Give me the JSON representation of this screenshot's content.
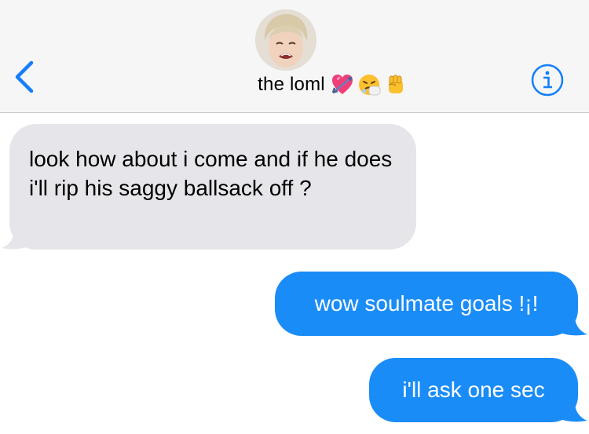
{
  "header": {
    "contact_name": "the loml",
    "emoji_icons": [
      "heart-with-arrow-icon",
      "sneezing-face-icon",
      "raised-fist-icon"
    ],
    "colors": {
      "accent": "#157efb",
      "background": "#f6f6f7"
    }
  },
  "messages": [
    {
      "direction": "incoming",
      "text": "look how about i come and if he does i'll rip his saggy ballsack off ?"
    },
    {
      "direction": "outgoing",
      "text": "wow soulmate goals !¡!"
    },
    {
      "direction": "outgoing",
      "text": "i'll ask one sec"
    }
  ],
  "colors": {
    "incoming_bubble": "#e5e5ea",
    "outgoing_bubble": "#1a8cf7"
  }
}
